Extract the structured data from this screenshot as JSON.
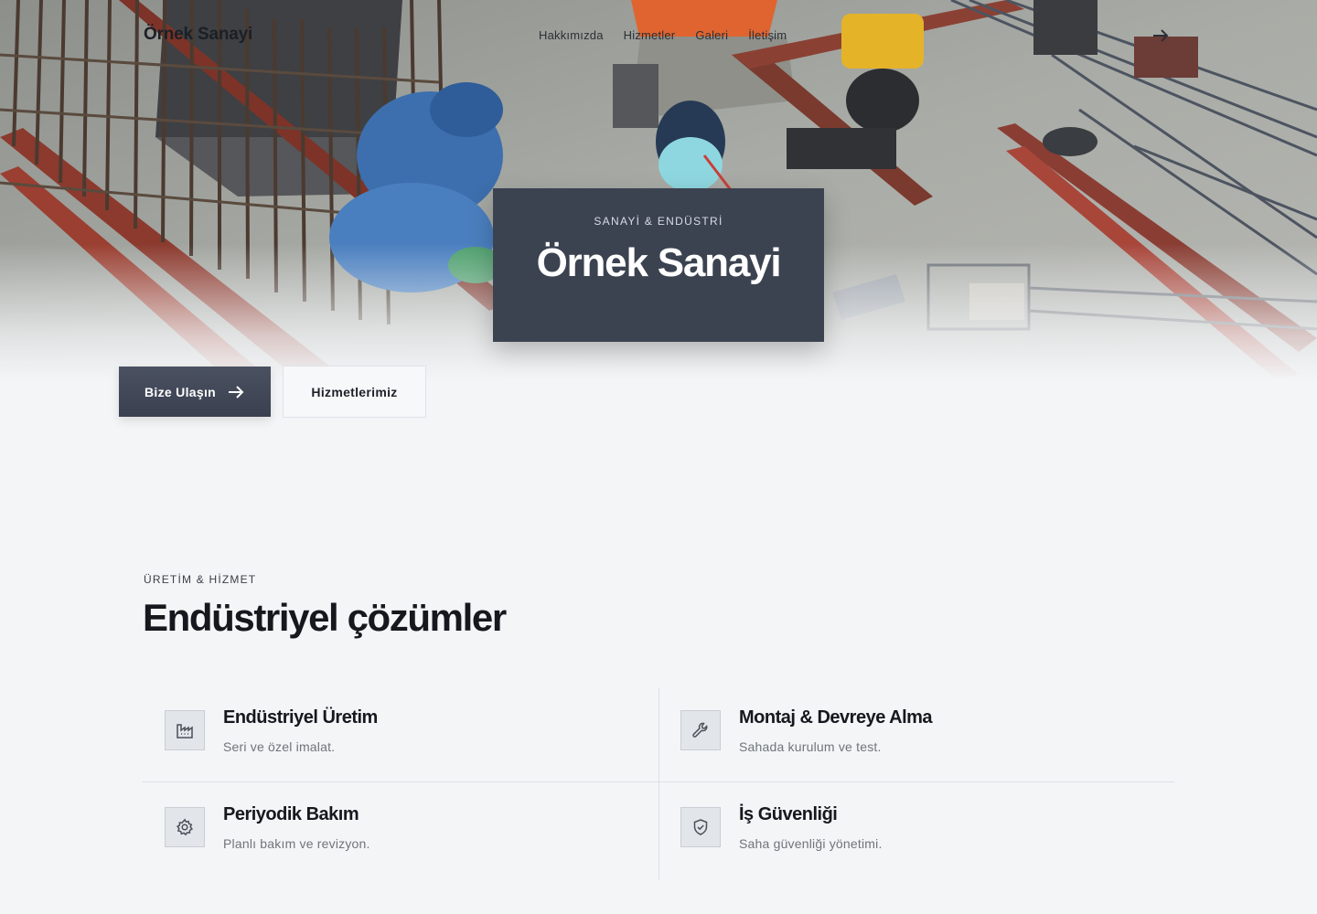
{
  "nav": {
    "brand": "Örnek Sanayi",
    "links": [
      "Hakkımızda",
      "Hizmetler",
      "Galeri",
      "İletişim"
    ]
  },
  "hero": {
    "eyebrow": "SANAYİ & ENDÜSTRİ",
    "title": "Örnek Sanayi",
    "primary_button": "Bize Ulaşın",
    "secondary_button": "Hizmetlerimiz"
  },
  "services": {
    "eyebrow": "ÜRETİM & HİZMET",
    "title": "Endüstriyel çözümler",
    "items": [
      {
        "title": "Endüstriyel Üretim",
        "description": "Seri ve özel imalat.",
        "icon": "factory-icon"
      },
      {
        "title": "Montaj & Devreye Alma",
        "description": "Sahada kurulum ve test.",
        "icon": "wrench-icon"
      },
      {
        "title": "Periyodik Bakım",
        "description": "Planlı bakım ve revizyon.",
        "icon": "gear-icon"
      },
      {
        "title": "İş Güvenliği",
        "description": "Saha güvenliği yönetimi.",
        "icon": "shield-check-icon"
      }
    ]
  },
  "colors": {
    "page_background": "#f3f5f7",
    "title_card": "#3b4250",
    "primary_button": "#424958",
    "heading_text": "#15181d",
    "muted_text": "#6f747c"
  }
}
